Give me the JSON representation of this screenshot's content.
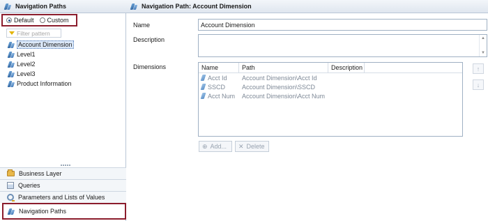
{
  "left_panel": {
    "title": "Navigation Paths",
    "radios": [
      {
        "label": "Default",
        "checked": true
      },
      {
        "label": "Custom",
        "checked": false
      }
    ],
    "filter_placeholder": "Filter pattern",
    "tree": [
      {
        "label": "Account Dimension",
        "selected": true
      },
      {
        "label": "Level1",
        "selected": false
      },
      {
        "label": "Level2",
        "selected": false
      },
      {
        "label": "Level3",
        "selected": false
      },
      {
        "label": "Product Information",
        "selected": false
      }
    ],
    "bottom_nav": [
      {
        "label": "Business Layer",
        "icon": "folder-icon"
      },
      {
        "label": "Queries",
        "icon": "queries-icon"
      },
      {
        "label": "Parameters and Lists of Values",
        "icon": "parameters-icon"
      },
      {
        "label": "Navigation Paths",
        "icon": "navigation-path-icon",
        "active": true
      }
    ]
  },
  "editor": {
    "title": "Navigation Path: Account Dimension",
    "name_label": "Name",
    "name_value": "Account Dimension",
    "description_label": "Description",
    "description_value": "",
    "dimensions_label": "Dimensions",
    "columns": [
      "Name",
      "Path",
      "Description"
    ],
    "rows": [
      {
        "name": "Acct Id",
        "path": "Account Dimension\\Acct Id",
        "description": ""
      },
      {
        "name": "SSCD",
        "path": "Account Dimension\\SSCD",
        "description": ""
      },
      {
        "name": "Acct Num",
        "path": "Account Dimension\\Acct Num",
        "description": ""
      }
    ],
    "add_label": "Add...",
    "delete_label": "Delete",
    "move_up_icon": "arrow-up-icon",
    "move_down_icon": "arrow-down-icon"
  },
  "colors": {
    "highlight_border": "#8b1c2c",
    "selection": "#dbe8f8"
  }
}
